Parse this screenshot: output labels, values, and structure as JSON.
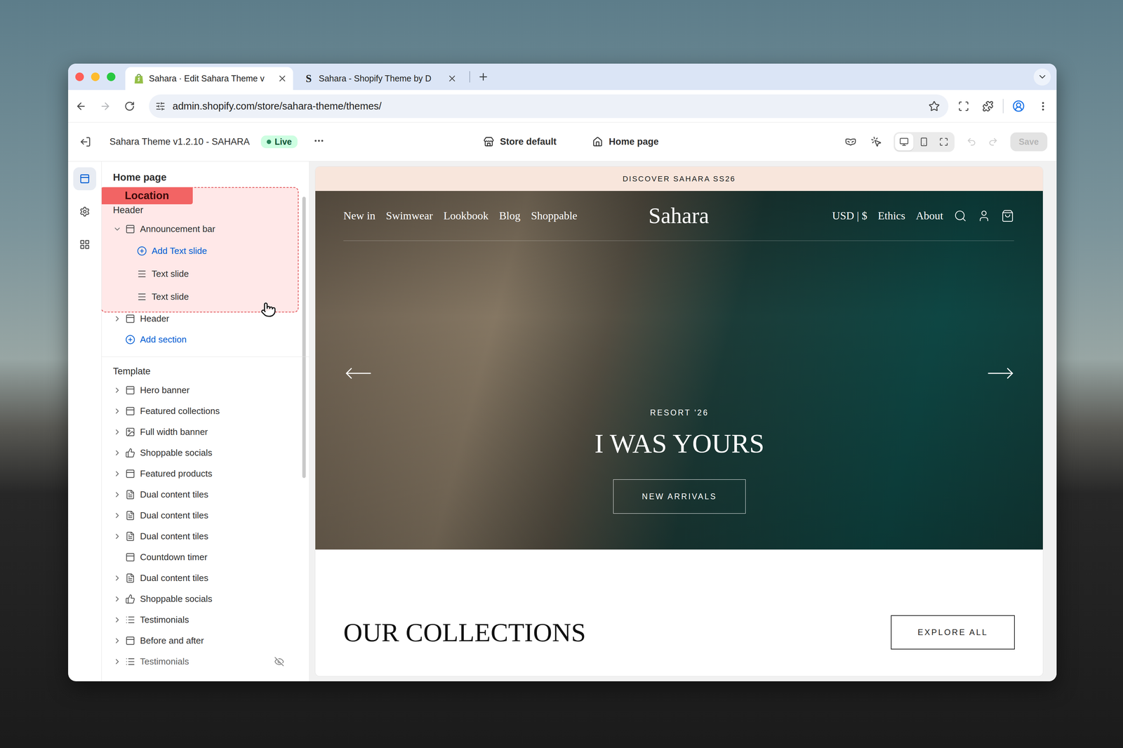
{
  "browser": {
    "tabs": [
      {
        "label": "Sahara · Edit Sahara Theme v",
        "kind": "shopify",
        "favicon": "",
        "selected": true
      },
      {
        "label": "Sahara - Shopify Theme by D",
        "kind": "letter",
        "favicon": "S",
        "selected": false
      }
    ],
    "history": {
      "back_enabled": true,
      "forward_enabled": false
    },
    "url": "admin.shopify.com/store/sahara-theme/themes/"
  },
  "editor": {
    "theme": "Sahara Theme v1.2.10 - SAHARA",
    "status": "Live",
    "context": [
      {
        "label": "Store default",
        "kind": "store"
      },
      {
        "label": "Home page",
        "kind": "page"
      }
    ],
    "devices": [
      {
        "kind": "desktop",
        "selected": true
      },
      {
        "kind": "mobile",
        "selected": false
      },
      {
        "kind": "full",
        "selected": false
      }
    ],
    "undo_enabled": false,
    "redo_enabled": false,
    "save": {
      "label": "Save",
      "disabled": true
    }
  },
  "rail": [
    {
      "kind": "sections",
      "selected": true
    },
    {
      "kind": "settings",
      "selected": false
    },
    {
      "kind": "apps",
      "selected": false
    }
  ],
  "sidebar": {
    "title": "Home page",
    "groups": [
      {
        "title": "Header",
        "items": [
          {
            "label": "Announcement bar",
            "kind": "section",
            "expandable": true,
            "expanded": true,
            "hidden": false,
            "children": [
              {
                "label": "Add Text slide",
                "kind": "add",
                "expandable": false,
                "expanded": false,
                "hidden": false
              },
              {
                "label": "Text slide",
                "kind": "block",
                "expandable": false,
                "expanded": false,
                "hidden": false
              },
              {
                "label": "Text slide",
                "kind": "block",
                "expandable": false,
                "expanded": false,
                "hidden": false
              }
            ]
          },
          {
            "label": "Header",
            "kind": "section",
            "expandable": true,
            "expanded": false,
            "hidden": false
          },
          {
            "label": "Add section",
            "kind": "add",
            "expandable": false,
            "expanded": false,
            "hidden": false
          }
        ]
      },
      {
        "title": "Template",
        "items": [
          {
            "label": "Hero banner",
            "kind": "section",
            "expandable": true,
            "expanded": false,
            "hidden": false
          },
          {
            "label": "Featured collections",
            "kind": "section",
            "expandable": true,
            "expanded": false,
            "hidden": false
          },
          {
            "label": "Full width banner",
            "kind": "media",
            "expandable": true,
            "expanded": false,
            "hidden": false
          },
          {
            "label": "Shoppable socials",
            "kind": "social",
            "expandable": true,
            "expanded": false,
            "hidden": false
          },
          {
            "label": "Featured products",
            "kind": "section",
            "expandable": true,
            "expanded": false,
            "hidden": false
          },
          {
            "label": "Dual content tiles",
            "kind": "content",
            "expandable": true,
            "expanded": false,
            "hidden": false
          },
          {
            "label": "Dual content tiles",
            "kind": "content",
            "expandable": true,
            "expanded": false,
            "hidden": false
          },
          {
            "label": "Dual content tiles",
            "kind": "content",
            "expandable": true,
            "expanded": false,
            "hidden": false
          },
          {
            "label": "Countdown timer",
            "kind": "section",
            "expandable": false,
            "expanded": false,
            "hidden": false
          },
          {
            "label": "Dual content tiles",
            "kind": "content",
            "expandable": true,
            "expanded": false,
            "hidden": false
          },
          {
            "label": "Shoppable socials",
            "kind": "social",
            "expandable": true,
            "expanded": false,
            "hidden": false
          },
          {
            "label": "Testimonials",
            "kind": "list",
            "expandable": true,
            "expanded": false,
            "hidden": false
          },
          {
            "label": "Before and after",
            "kind": "section",
            "expandable": true,
            "expanded": false,
            "hidden": false
          },
          {
            "label": "Testimonials",
            "kind": "list",
            "expandable": true,
            "expanded": false,
            "hidden": true
          }
        ]
      }
    ]
  },
  "overlay": {
    "label": "Location"
  },
  "preview": {
    "announcement": "DISCOVER SAHARA SS26",
    "nav_left": [
      "New in",
      "Swimwear",
      "Lookbook",
      "Blog",
      "Shoppable"
    ],
    "logo": "Sahara",
    "nav_right": [
      "USD | $",
      "Ethics",
      "About"
    ],
    "hero": {
      "eyebrow": "RESORT '26",
      "title": "I WAS YOURS",
      "button": "NEW ARRIVALS"
    },
    "collections": {
      "title": "OUR COLLECTIONS",
      "button": "EXPLORE ALL"
    }
  }
}
